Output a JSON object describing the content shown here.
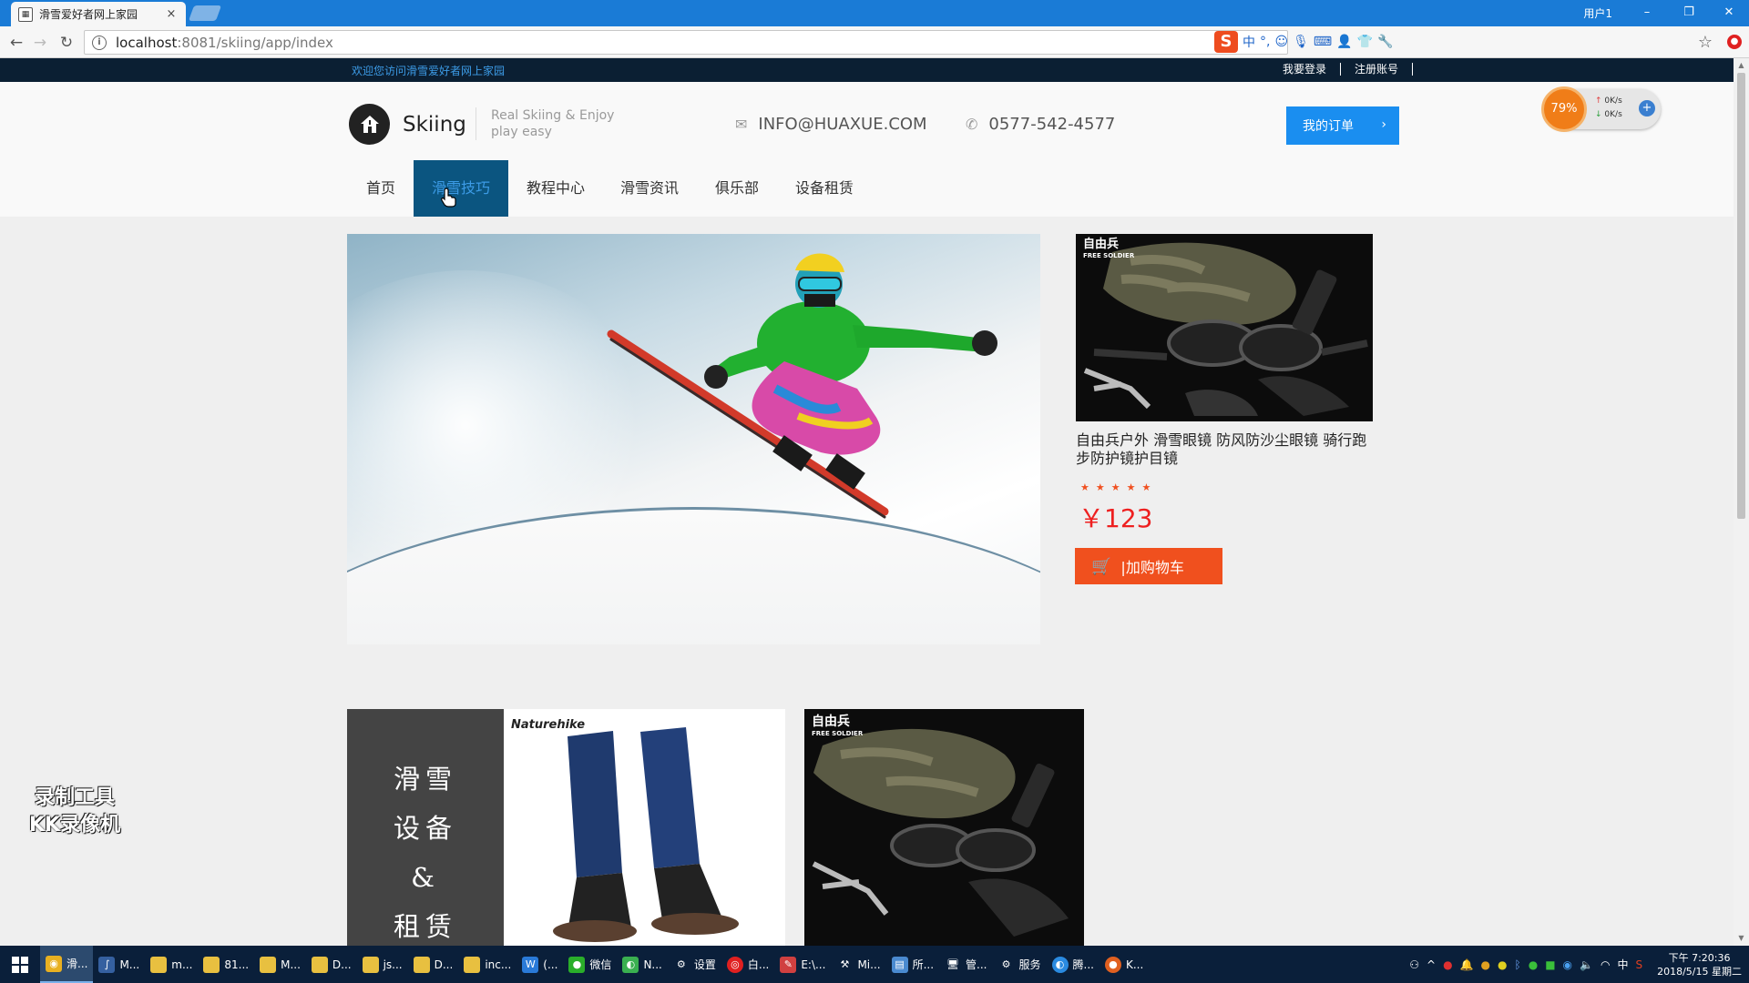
{
  "browser": {
    "tab_title": "滑雪爱好者网上家园",
    "tab_close": "×",
    "window_user": "用户1",
    "url_host": "localhost",
    "url_rest": ":8081/skiing/app/index",
    "win_min": "–",
    "win_restore": "❐",
    "win_close": "✕"
  },
  "site": {
    "welcome": "欢迎您访问滑雪爱好者网上家园",
    "login": "我要登录",
    "register": "注册账号",
    "brand": "Skiing",
    "tagline_1": "Real Skiing & Enjoy",
    "tagline_2": "play easy",
    "email": "INFO@HUAXUE.COM",
    "phone": "0577-542-4577",
    "orders_button": "我的订单",
    "nav": [
      "首页",
      "滑雪技巧",
      "教程中心",
      "滑雪资讯",
      "俱乐部",
      "设备租赁"
    ],
    "nav_active": 1
  },
  "speed_widget": {
    "percent": "79%",
    "up": "0K/s",
    "down": "0K/s"
  },
  "product": {
    "title": "自由兵户外 滑雪眼镜 防风防沙尘眼镜 骑行跑步防护镜护目镜",
    "rating": 5,
    "price": "￥123",
    "cart_button": "|加购物车",
    "image_brand": "自由兵",
    "image_brand_sub": "FREE SOLDIER"
  },
  "banner": {
    "lines": [
      "滑雪",
      "设备",
      "&",
      "租赁"
    ],
    "gaiter_brand": "Naturehike",
    "gear_brand": "自由兵",
    "gear_brand_sub": "FREE SOLDIER"
  },
  "watermark": {
    "line1": "录制工具",
    "line2": "KK录像机"
  },
  "taskbar": {
    "items": [
      "滑...",
      "M...",
      "m...",
      "81...",
      "M...",
      "D...",
      "js...",
      "D...",
      "inc...",
      "(...",
      "微信",
      "N...",
      "设置",
      "白...",
      "E:\\...",
      "Mi...",
      "所...",
      "管...",
      "服务",
      "腾...",
      "K..."
    ],
    "time": "下午 7:20:36",
    "date": "2018/5/15 星期二",
    "ime": "中"
  },
  "colors": {
    "accent_blue": "#1a8ef0",
    "nav_active_bg": "#0b5580",
    "cart_orange": "#f0501e",
    "price_red": "#ee2020"
  }
}
